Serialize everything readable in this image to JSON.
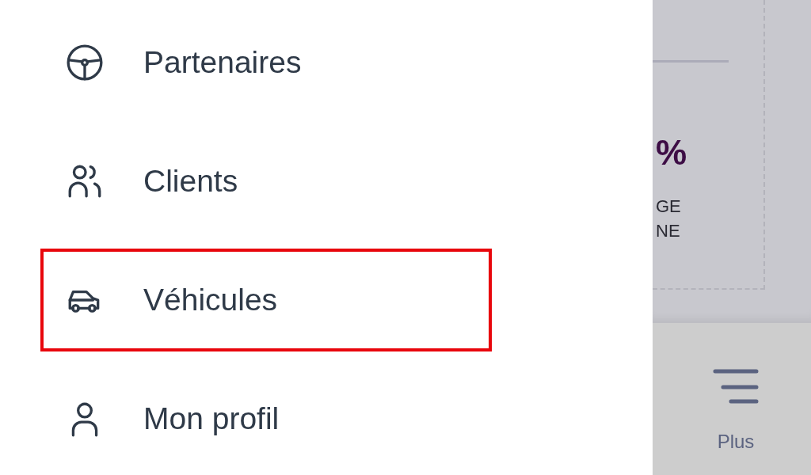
{
  "drawer": {
    "items": [
      {
        "label": "Partenaires",
        "highlighted": false
      },
      {
        "label": "Clients",
        "highlighted": false
      },
      {
        "label": "Véhicules",
        "highlighted": true
      },
      {
        "label": "Mon profil",
        "highlighted": false
      }
    ]
  },
  "background": {
    "card": {
      "value": "%",
      "caption": [
        "GE",
        "NE"
      ]
    }
  },
  "bottom_nav": {
    "items": [
      {
        "label": "Plus"
      }
    ]
  }
}
